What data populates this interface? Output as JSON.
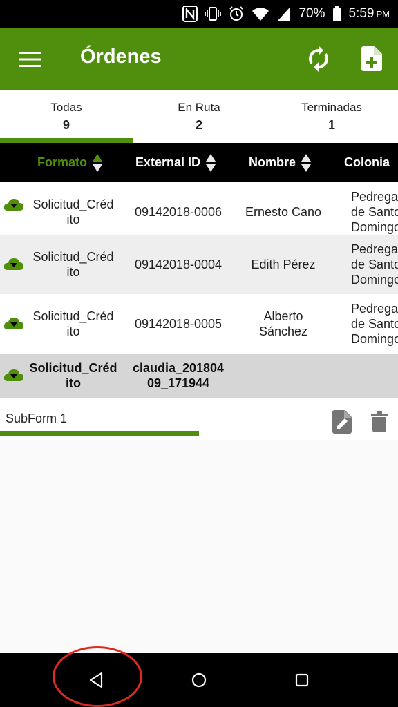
{
  "status_bar": {
    "battery": "70%",
    "time": "5:59",
    "time_suffix": "PM"
  },
  "app_bar": {
    "title": "Órdenes"
  },
  "tabs": [
    {
      "label": "Todas",
      "count": "9"
    },
    {
      "label": "En Ruta",
      "count": "2"
    },
    {
      "label": "Terminadas",
      "count": "1"
    }
  ],
  "table": {
    "columns": [
      "Formato",
      "External ID",
      "Nombre",
      "Colonia"
    ],
    "rows": [
      {
        "formato": "Solicitud_Créd\nito",
        "external_id": "09142018-0006",
        "nombre": "Ernesto Cano",
        "colonia": "Pedrega\nde Santo\nDomingo"
      },
      {
        "formato": "Solicitud_Créd\nito",
        "external_id": "09142018-0004",
        "nombre": "Edith Pérez",
        "colonia": "Pedrega\nde Santo\nDomingo"
      },
      {
        "formato": "Solicitud_Créd\nito",
        "external_id": "09142018-0005",
        "nombre": "Alberto\nSánchez",
        "colonia": "Pedrega\nde Santo\nDomingo"
      },
      {
        "formato": "Solicitud_Créd\nito",
        "external_id": "claudia_201804\n09_171944",
        "nombre": "",
        "colonia": ""
      }
    ]
  },
  "subform": {
    "label": "SubForm 1"
  },
  "colors": {
    "brand_green": "#4f8f0d",
    "annotation_red": "#e0281e"
  }
}
